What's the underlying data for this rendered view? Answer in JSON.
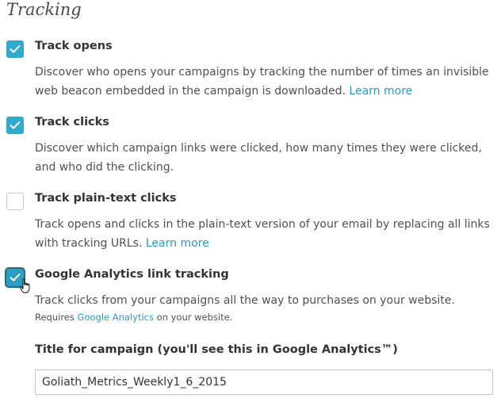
{
  "section_title": "Tracking",
  "options": [
    {
      "title": "Track opens",
      "checked": true,
      "desc": "Discover who opens your campaigns by tracking the number of times an invisible web beacon embedded in the campaign is downloaded.",
      "link": "Learn more"
    },
    {
      "title": "Track clicks",
      "checked": true,
      "desc": "Discover which campaign links were clicked, how many times they were clicked, and who did the clicking."
    },
    {
      "title": "Track plain-text clicks",
      "checked": false,
      "desc": "Track opens and clicks in the plain-text version of your email by replacing all links with tracking URLs.",
      "link": "Learn more"
    },
    {
      "title": "Google Analytics link tracking",
      "checked": true,
      "desc": "Track clicks from your campaigns all the way to purchases on your website.",
      "note_prefix": "Requires",
      "note_link": "Google Analytics",
      "note_suffix": "on your website."
    }
  ],
  "campaign_title": {
    "label": "Title for campaign (you'll see this in Google Analytics™)",
    "value": "Goliath_Metrics_Weekly1_6_2015"
  },
  "colors": {
    "checkbox_checked": "#35a9cd",
    "link": "#2a9bbf"
  },
  "icons": {
    "checkmark": "check-icon",
    "pointer": "hand-cursor-icon"
  }
}
